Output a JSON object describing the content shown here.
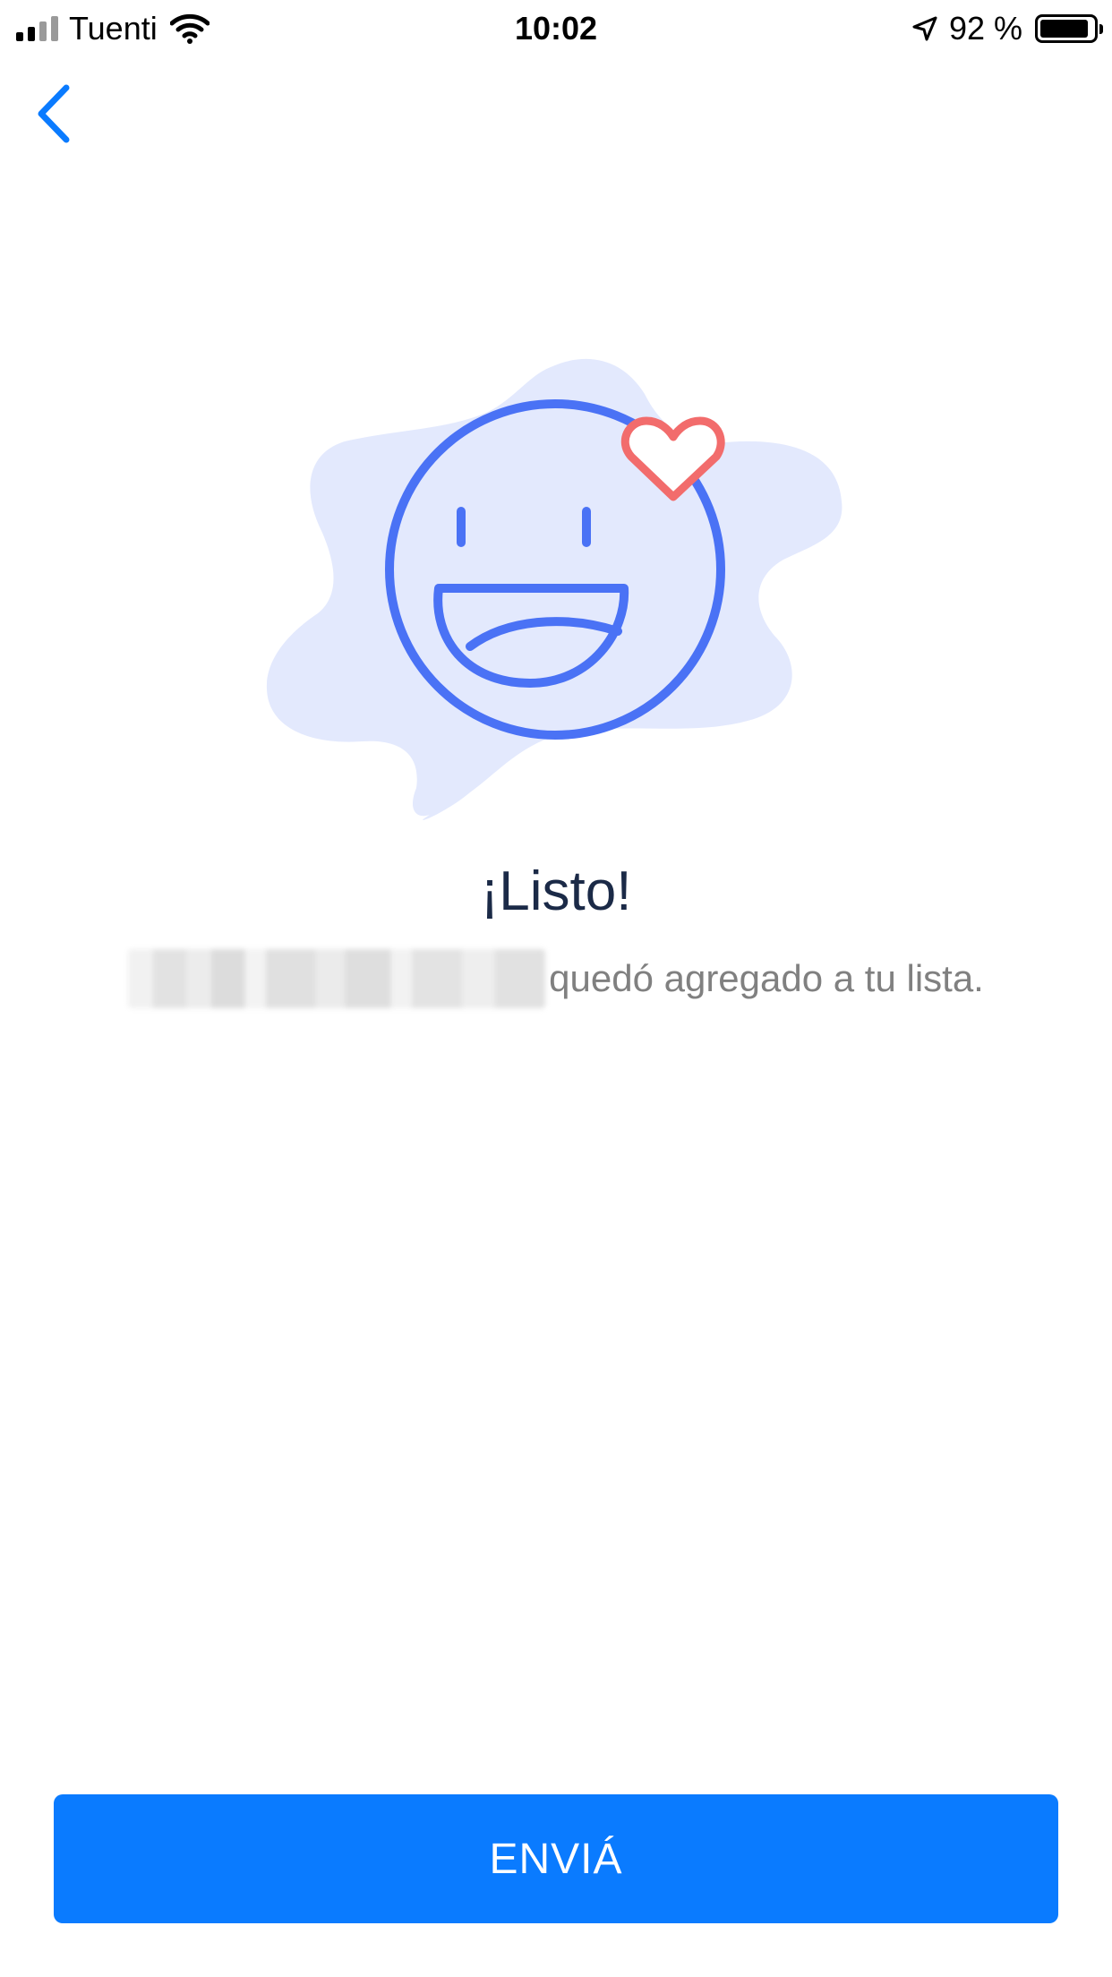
{
  "status_bar": {
    "carrier": "Tuenti",
    "time": "10:02",
    "battery_percent": "92 %",
    "battery_level": 0.92,
    "icons": [
      "signal-icon",
      "wifi-icon",
      "location-arrow-icon",
      "battery-icon"
    ]
  },
  "nav": {
    "back_icon": "chevron-left-icon"
  },
  "illustration": {
    "icons": [
      "smiley-face-icon",
      "heart-icon"
    ],
    "colors": {
      "blob": "#e3e9fd",
      "face": "#4a72f5",
      "heart": "#f26c6c"
    }
  },
  "content": {
    "title": "¡Listo!",
    "subtitle_suffix": "quedó agregado a tu lista."
  },
  "actions": {
    "send_label": "ENVIÁ"
  },
  "colors": {
    "accent": "#0a7bff",
    "title": "#1b2a47",
    "subtitle": "#808080"
  }
}
